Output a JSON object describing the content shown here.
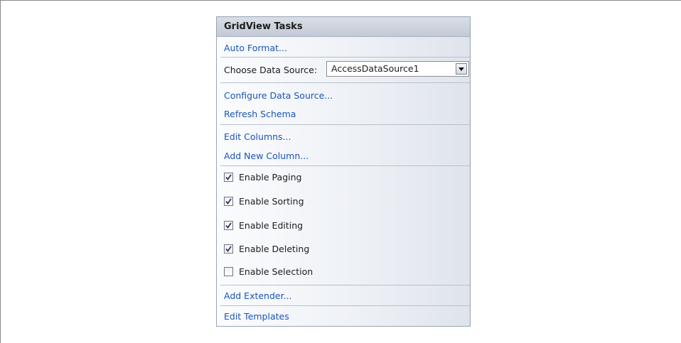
{
  "panel": {
    "title": "GridView Tasks",
    "auto_format": "Auto Format...",
    "choose_data_source_label": "Choose Data Source:",
    "data_source_value": "AccessDataSource1",
    "configure_data_source": "Configure Data Source...",
    "refresh_schema": "Refresh Schema",
    "edit_columns": "Edit Columns...",
    "add_new_column": "Add New Column...",
    "options": [
      {
        "label": "Enable Paging",
        "checked": true
      },
      {
        "label": "Enable Sorting",
        "checked": true
      },
      {
        "label": "Enable Editing",
        "checked": true
      },
      {
        "label": "Enable Deleting",
        "checked": true
      },
      {
        "label": "Enable Selection",
        "checked": false
      }
    ],
    "add_extender": "Add Extender...",
    "edit_templates": "Edit Templates"
  },
  "colors": {
    "link": "#1a54b8",
    "header_bg": "#c8ced9",
    "check": "#2b3a52"
  },
  "icons": {
    "dropdown": "chevron-down-icon",
    "checkbox_checked": "checkmark-icon"
  }
}
